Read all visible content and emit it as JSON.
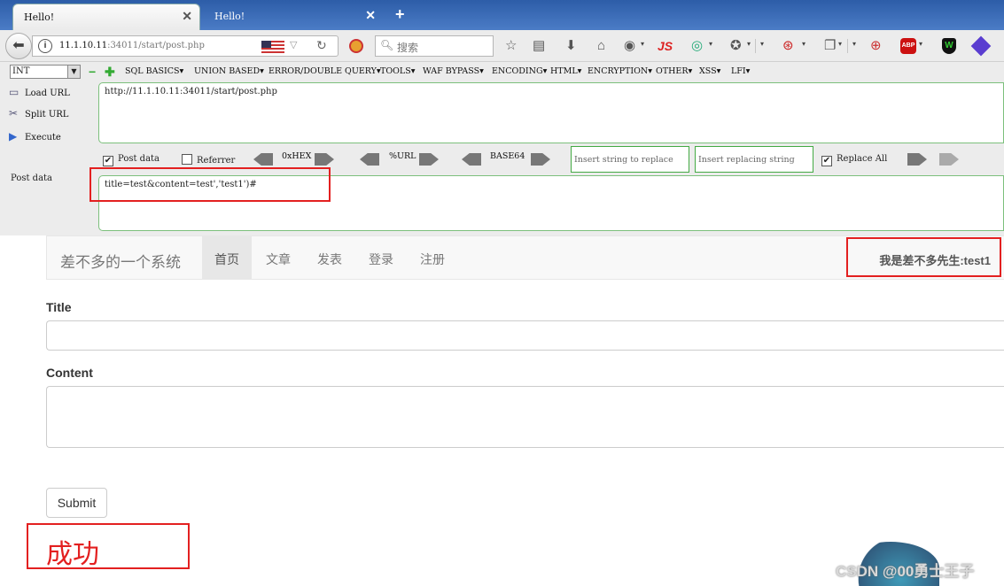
{
  "tabs": [
    {
      "title": "Hello!",
      "active": true
    },
    {
      "title": "Hello!",
      "active": false
    }
  ],
  "navbar": {
    "url_host": "11.1.10.11",
    "url_rest": ":34011/start/post.php",
    "search_placeholder": "搜索",
    "js_label": "JS",
    "abp_label": "ABP",
    "shield_label": "W",
    "icons": [
      "back-icon",
      "info-icon",
      "flag-us-icon",
      "dropdown-icon",
      "reload-icon",
      "block-icon",
      "search-icon",
      "star-icon",
      "reading-list-icon",
      "download-icon",
      "home-icon",
      "globe-icon",
      "js-icon",
      "chrome-icon",
      "palette-icon",
      "firebug-icon",
      "clipboard-icon",
      "zoom-icon",
      "abp-icon",
      "shield-icon",
      "cube-icon"
    ]
  },
  "hackbar": {
    "type_select": "INT",
    "menus": [
      "SQL BASICS▾",
      "UNION BASED▾",
      "ERROR/DOUBLE QUERY▾",
      "TOOLS▾",
      "WAF BYPASS▾",
      "ENCODING▾",
      "HTML▾",
      "ENCRYPTION▾",
      "OTHER▾",
      "XSS▾",
      "LFI▾"
    ],
    "load_url": "Load URL",
    "split_url": "Split URL",
    "execute": "Execute",
    "url_value": "http://11.1.10.11:34011/start/post.php",
    "post_data_check": "Post data",
    "referrer_check": "Referrer",
    "oxhex": "0xHEX",
    "url_enc": "%URL",
    "base64": "BASE64",
    "insert_placeholder": "Insert string to replace",
    "replacing_placeholder": "Insert replacing string",
    "replace_all": "Replace All",
    "post_label": "Post data",
    "post_value": "title=test&content=test','test1')#"
  },
  "site": {
    "brand": "差不多的一个系统",
    "nav": [
      {
        "label": "首页",
        "active": true
      },
      {
        "label": "文章",
        "active": false
      },
      {
        "label": "发表",
        "active": false
      },
      {
        "label": "登录",
        "active": false
      },
      {
        "label": "注册",
        "active": false
      }
    ],
    "user": "我是差不多先生:test1",
    "title_label": "Title",
    "content_label": "Content",
    "submit": "Submit",
    "annotation": "成功",
    "watermark": "CSDN @00勇士王子"
  }
}
